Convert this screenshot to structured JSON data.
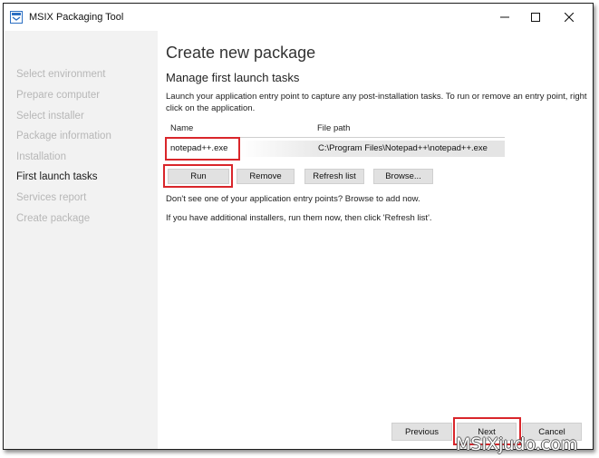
{
  "window": {
    "title": "MSIX Packaging Tool"
  },
  "sidebar": {
    "items": [
      {
        "label": "Select environment",
        "active": false
      },
      {
        "label": "Prepare computer",
        "active": false
      },
      {
        "label": "Select installer",
        "active": false
      },
      {
        "label": "Package information",
        "active": false
      },
      {
        "label": "Installation",
        "active": false
      },
      {
        "label": "First launch tasks",
        "active": true
      },
      {
        "label": "Services report",
        "active": false
      },
      {
        "label": "Create package",
        "active": false
      }
    ]
  },
  "main": {
    "page_title": "Create new package",
    "section_title": "Manage first launch tasks",
    "description": "Launch your application entry point to capture any post-installation tasks. To run or remove an entry point, right click on the application.",
    "table": {
      "columns": [
        "Name",
        "File path"
      ],
      "rows": [
        {
          "name": "notepad++.exe",
          "path": "C:\\Program Files\\Notepad++\\notepad++.exe"
        }
      ]
    },
    "buttons": {
      "run": "Run",
      "remove": "Remove",
      "refresh": "Refresh list",
      "browse": "Browse..."
    },
    "hint1": "Don't see one of your application entry points? Browse to add now.",
    "hint2": "If you have additional installers, run them now, then click 'Refresh list'."
  },
  "footer": {
    "previous": "Previous",
    "next": "Next",
    "cancel": "Cancel"
  },
  "watermark": "MSIXjudo.com",
  "colors": {
    "highlight": "#d9262b",
    "sidebar_bg": "#f2f2f2",
    "button_bg": "#e1e1e1",
    "inactive_nav": "#b7b7b7"
  }
}
